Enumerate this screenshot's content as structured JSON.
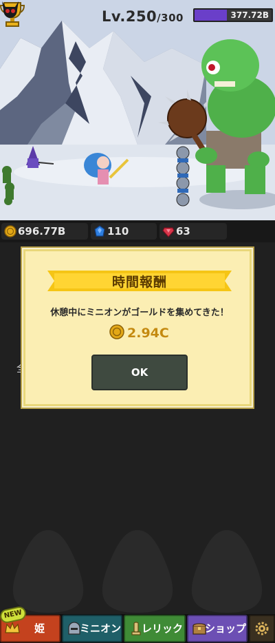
{
  "hud": {
    "level_text": "Lv.250",
    "level_max": "/300",
    "boss_hp_text": "377.72B",
    "boss_hp_fraction": 0.42
  },
  "currency": {
    "gold": "696.77B",
    "gems": "110",
    "rubies": "63"
  },
  "background": {
    "partial_text": "全"
  },
  "dialog": {
    "title": "時間報酬",
    "message": "休憩中にミニオンがゴールドを集めてきた！",
    "reward_amount": "2.94C",
    "ok_label": "OK"
  },
  "nav": {
    "new_badge": "NEW",
    "princess": "姫",
    "minion": "ミニオン",
    "relic": "レリック",
    "shop": "ショップ"
  },
  "icons": [
    "trophy-icon",
    "boss-skull-icon",
    "gold-coin-icon",
    "gem-icon",
    "ruby-icon",
    "princess-crown-icon",
    "minion-helmet-icon",
    "relic-icon",
    "shop-chest-icon",
    "settings-gear-icon"
  ],
  "colors": {
    "boss_bar": "#6a3fc9",
    "dialog_bg": "#fbeeb3",
    "ribbon": "#f5c515",
    "ok_button": "#3f4a40",
    "nav_princess": "#c4421e",
    "nav_minion": "#1f5f68",
    "nav_relic": "#3f8b36",
    "nav_shop": "#6c4fb4"
  }
}
